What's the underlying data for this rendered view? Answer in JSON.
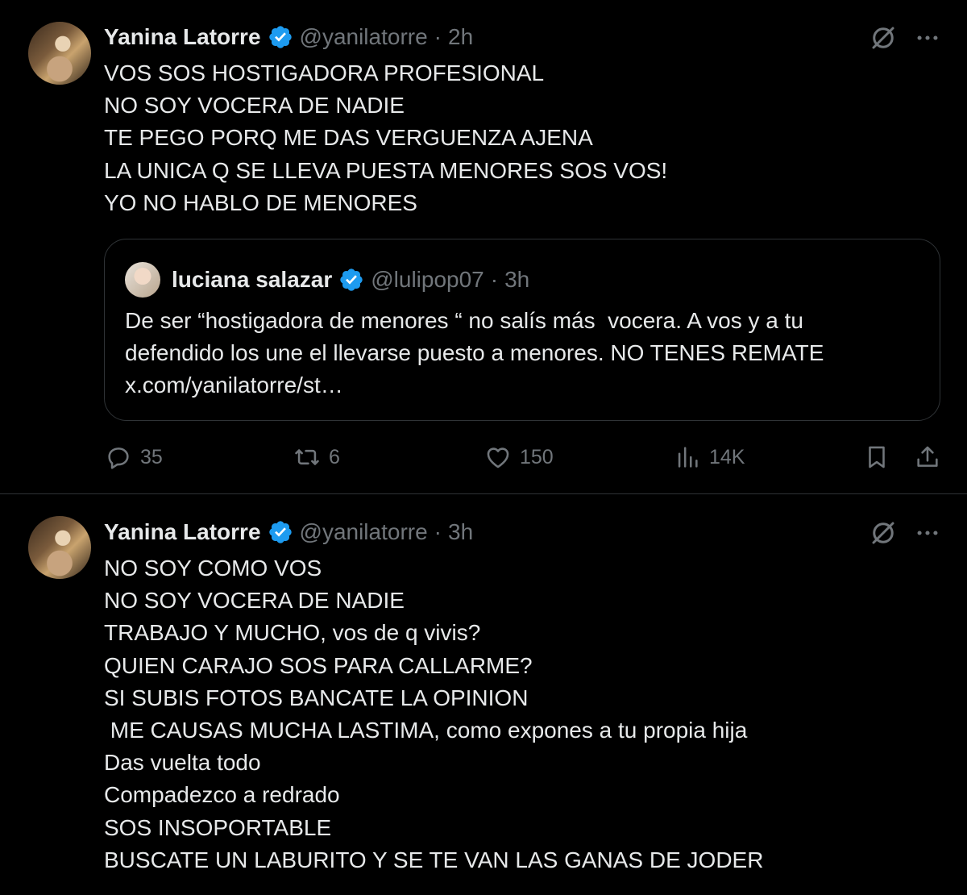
{
  "tweets": [
    {
      "author_name": "Yanina Latorre",
      "handle": "@yanilatorre",
      "separator": "·",
      "time": "2h",
      "text_lines": [
        "VOS SOS HOSTIGADORA PROFESIONAL",
        "NO SOY VOCERA DE NADIE",
        "TE PEGO PORQ ME DAS VERGUENZA AJENA",
        "LA UNICA Q SE LLEVA PUESTA MENORES SOS VOS!",
        "YO NO HABLO DE MENORES"
      ],
      "quote": {
        "author_name": "luciana salazar",
        "handle": "@lulipop07",
        "separator": "·",
        "time": "3h",
        "text_lines": [
          "De ser “hostigadora de menores “ no salís más  vocera. A vos y a tu",
          "defendido los une el llevarse puesto a menores. NO TENES REMATE",
          "x.com/yanilatorre/st…"
        ]
      },
      "actions": {
        "replies": "35",
        "reposts": "6",
        "likes": "150",
        "views": "14K"
      }
    },
    {
      "author_name": "Yanina Latorre",
      "handle": "@yanilatorre",
      "separator": "·",
      "time": "3h",
      "text_lines": [
        "NO SOY COMO VOS",
        "NO SOY VOCERA DE NADIE",
        "TRABAJO Y MUCHO, vos de q vivis?",
        "QUIEN CARAJO SOS PARA CALLARME?",
        "SI SUBIS FOTOS BANCATE LA OPINION",
        " ME CAUSAS MUCHA LASTIMA, como expones a tu propia hija",
        "Das vuelta todo",
        "Compadezco a redrado",
        "SOS INSOPORTABLE",
        "BUSCATE UN LABURITO Y SE TE VAN LAS GANAS DE JODER"
      ]
    }
  ],
  "icons": {
    "verified": "verified-badge-icon",
    "grok": "grok-icon",
    "more": "more-icon",
    "reply": "reply-icon",
    "repost": "repost-icon",
    "like": "like-icon",
    "views": "views-icon",
    "bookmark": "bookmark-icon",
    "share": "share-icon"
  },
  "colors": {
    "background": "#000000",
    "text": "#e7e9ea",
    "muted": "#71767b",
    "verified": "#1d9bf0",
    "border": "#2f3336"
  }
}
